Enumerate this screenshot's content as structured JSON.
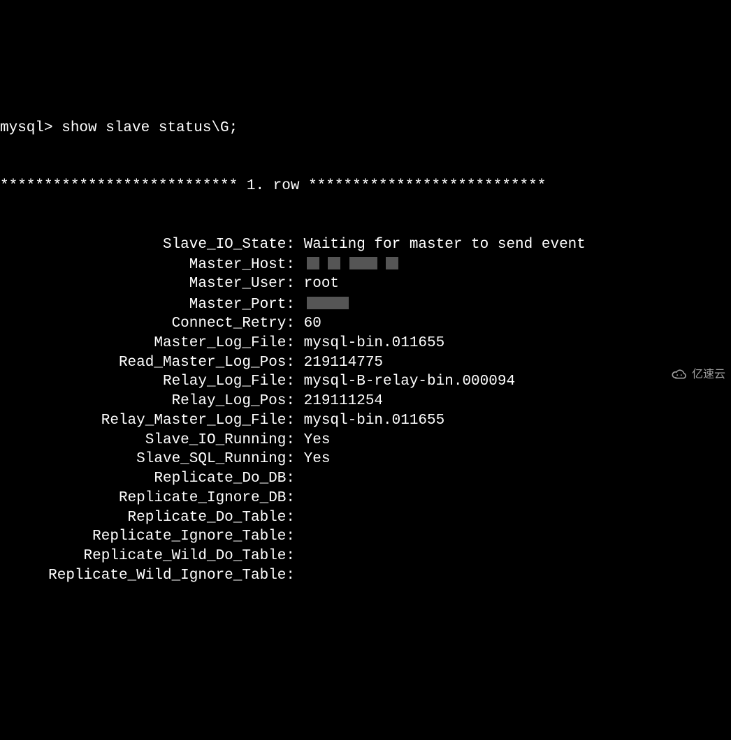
{
  "prompt": "mysql> show slave status\\G;",
  "separator": "*************************** 1. row ***************************",
  "rows": [
    {
      "key": "Slave_IO_State",
      "val": "Waiting for master to send event"
    },
    {
      "key": "Master_Host",
      "val": "",
      "redacted": true
    },
    {
      "key": "Master_User",
      "val": "root"
    },
    {
      "key": "Master_Port",
      "val": "",
      "redacted_short": true
    },
    {
      "key": "Connect_Retry",
      "val": "60"
    },
    {
      "key": "Master_Log_File",
      "val": "mysql-bin.011655"
    },
    {
      "key": "Read_Master_Log_Pos",
      "val": "219114775"
    },
    {
      "key": "Relay_Log_File",
      "val": "mysql-B-relay-bin.000094"
    },
    {
      "key": "Relay_Log_Pos",
      "val": "219111254"
    },
    {
      "key": "Relay_Master_Log_File",
      "val": "mysql-bin.011655"
    },
    {
      "key": "Slave_IO_Running",
      "val": "Yes"
    },
    {
      "key": "Slave_SQL_Running",
      "val": "Yes"
    },
    {
      "key": "Replicate_Do_DB",
      "val": ""
    },
    {
      "key": "Replicate_Ignore_DB",
      "val": ""
    },
    {
      "key": "Replicate_Do_Table",
      "val": ""
    },
    {
      "key": "Replicate_Ignore_Table",
      "val": ""
    },
    {
      "key": "Replicate_Wild_Do_Table",
      "val": ""
    },
    {
      "key": "Replicate_Wild_Ignore_Table",
      "val": ""
    }
  ],
  "watermark_text": "亿速云"
}
